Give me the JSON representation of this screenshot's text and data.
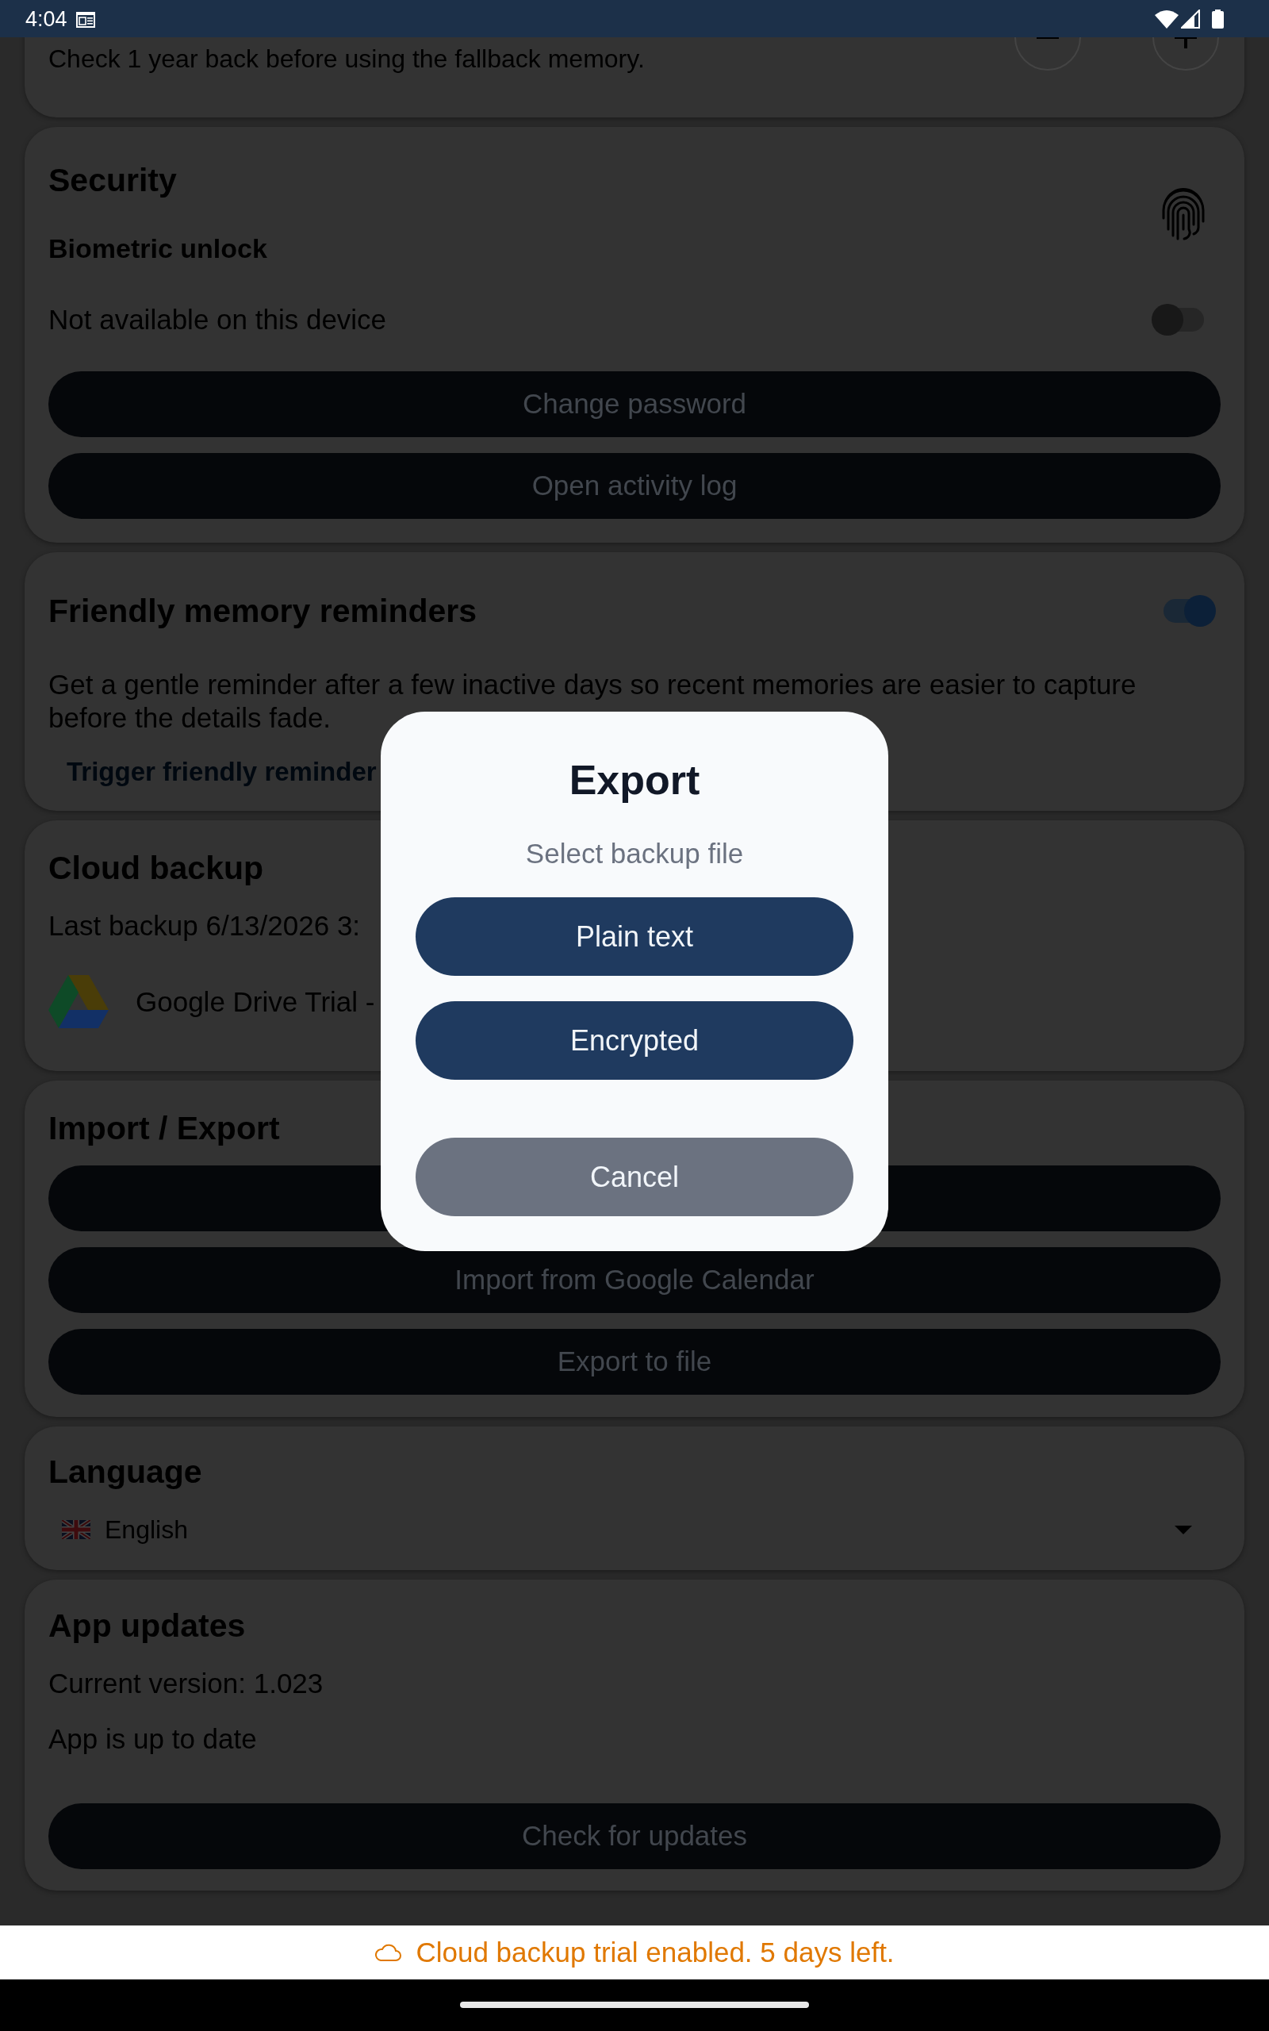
{
  "status_bar": {
    "time": "4:04"
  },
  "lookback": {
    "description": "Check 1 year back before using the fallback memory."
  },
  "security": {
    "title": "Security",
    "biometric": {
      "label": "Biometric unlock",
      "note": "Not available on this device",
      "on": false
    },
    "buttons": [
      {
        "label": "Change password"
      },
      {
        "label": "Open activity log"
      }
    ]
  },
  "reminders": {
    "title": "Friendly memory reminders",
    "on": true,
    "description": "Get a gentle reminder after a few inactive days so recent memories are easier to capture before the details fade.",
    "action": "Trigger friendly reminder"
  },
  "cloud_backup": {
    "title": "Cloud backup",
    "last_backup": "Last backup 6/13/2026 3:",
    "provider": "Google Drive Trial -"
  },
  "import_export": {
    "title": "Import / Export",
    "buttons": [
      {
        "kind": "covered"
      },
      {
        "kind": "labeled",
        "label": "Import from Google Calendar"
      },
      {
        "kind": "labeled",
        "label": "Export to file"
      }
    ]
  },
  "language": {
    "title": "Language",
    "dropdown": {
      "value": "English"
    }
  },
  "app_updates": {
    "title": "App updates",
    "current_version": "Current version: 1.023",
    "status": "App is up to date",
    "button": "Check for updates"
  },
  "banner": {
    "text": "Cloud backup trial enabled. 5 days left."
  },
  "dialog": {
    "title": "Export",
    "subtitle": "Select backup file",
    "buttons": [
      {
        "label": "Plain text",
        "kind": "primary"
      },
      {
        "label": "Encrypted",
        "kind": "primary"
      },
      {
        "label": "Cancel",
        "kind": "secondary"
      }
    ]
  }
}
